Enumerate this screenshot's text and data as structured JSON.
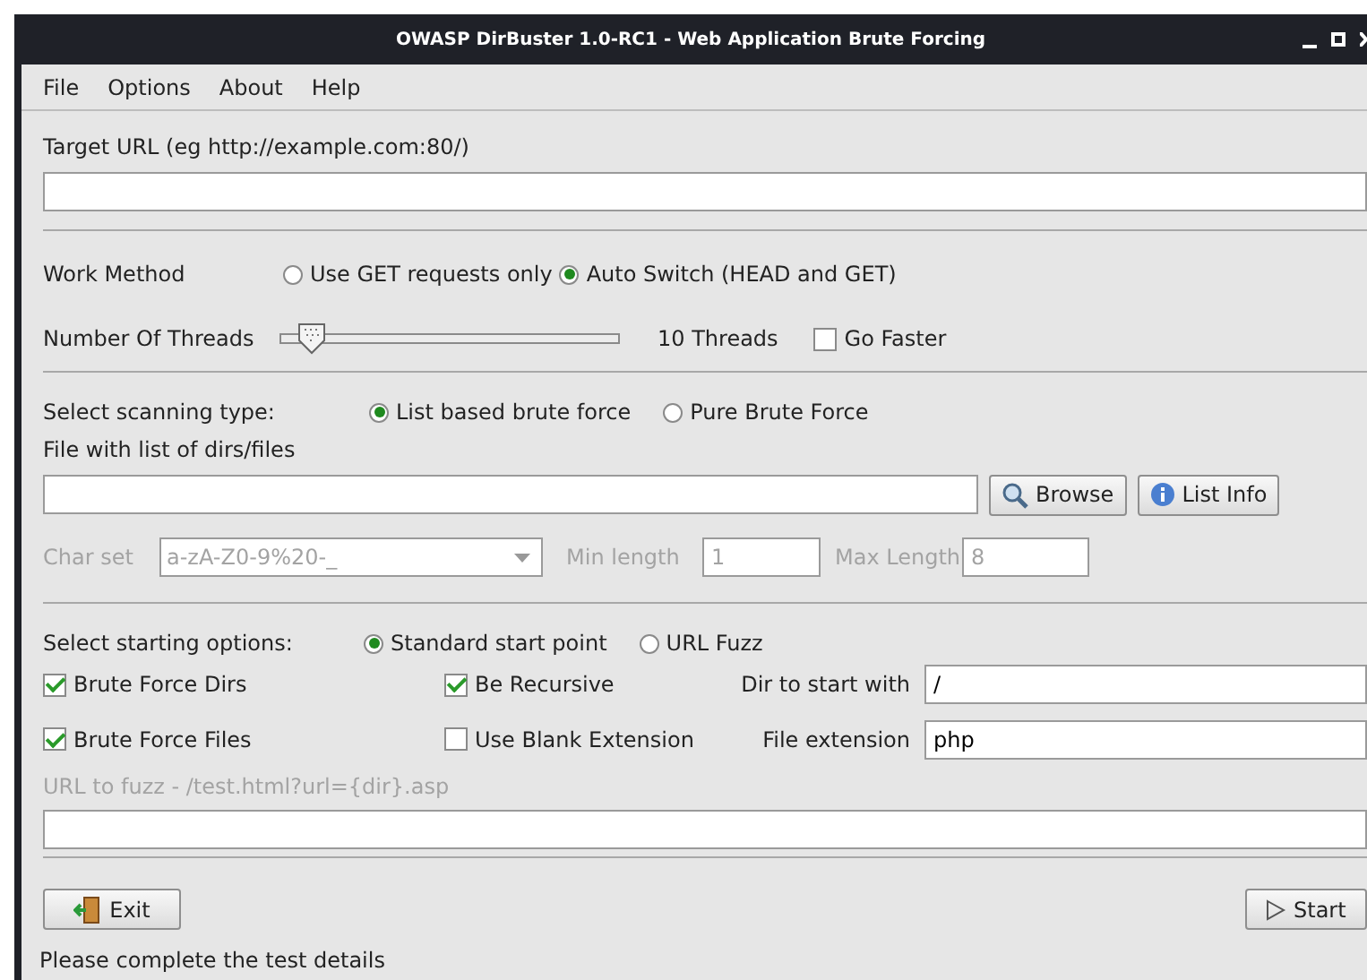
{
  "window": {
    "title": "OWASP DirBuster 1.0-RC1 - Web Application Brute Forcing"
  },
  "menu": [
    "File",
    "Options",
    "About",
    "Help"
  ],
  "target_url": {
    "label": "Target URL (eg http://example.com:80/)"
  },
  "work_method": {
    "label": "Work Method",
    "options": [
      {
        "label": "Use GET requests only",
        "selected": false
      },
      {
        "label": "Auto Switch (HEAD and GET)",
        "selected": true
      }
    ]
  },
  "threads": {
    "label": "Number Of Threads",
    "level": 0.06,
    "reading": "10 Threads",
    "go_faster": {
      "label": "Go Faster",
      "checked": false
    }
  },
  "scanning_type": {
    "label": "Select scanning type:",
    "options": [
      {
        "label": "List based brute force",
        "selected": true
      },
      {
        "label": "Pure Brute Force",
        "selected": false
      }
    ]
  },
  "file_list": {
    "label": "File with list of dirs/files",
    "buttons": [
      {
        "label": "Browse",
        "kind": "search"
      },
      {
        "label": "List Info",
        "kind": "info"
      }
    ]
  },
  "pure_brute_force": {
    "disabled": true,
    "char_set": {
      "label": "Char set",
      "value": "a-zA-Z0-9%20-_"
    },
    "min_length": {
      "label": "Min length",
      "value": "1"
    },
    "max_length": {
      "label": "Max Length",
      "value": "8"
    }
  },
  "starting_options": {
    "label": "Select starting options:",
    "options": [
      {
        "label": "Standard start point",
        "selected": true
      },
      {
        "label": "URL Fuzz",
        "selected": false
      }
    ]
  },
  "brute_force_dirs": {
    "label": "Brute Force Dirs",
    "checked": true
  },
  "be_recursive": {
    "label": "Be Recursive",
    "checked": true
  },
  "dir_to_start": {
    "label": "Dir to start with",
    "value": "/"
  },
  "brute_force_files": {
    "label": "Brute Force Files",
    "checked": true
  },
  "use_blank_extension": {
    "label": "Use Blank Extension",
    "checked": false
  },
  "file_extension": {
    "label": "File extension",
    "value": "php"
  },
  "url_fuzz": {
    "label": "URL to fuzz - /test.html?url={dir}.asp",
    "disabled": true
  },
  "buttons": [
    {
      "label": "Exit",
      "kind": "exit"
    },
    {
      "label": "Start",
      "kind": "start"
    }
  ],
  "status": "Please complete the test details"
}
